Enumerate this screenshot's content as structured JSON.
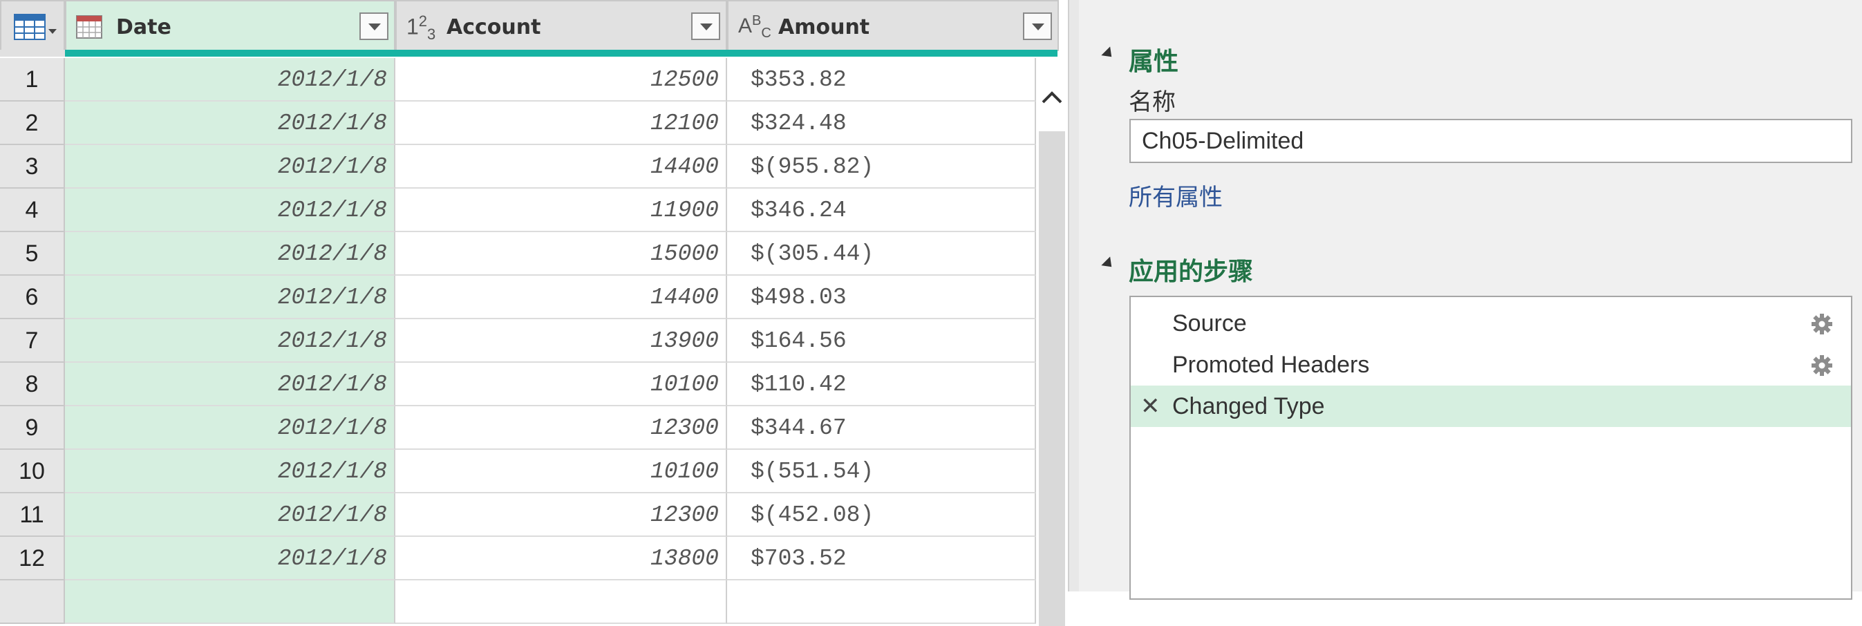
{
  "grid": {
    "columns": [
      {
        "name": "Date",
        "type_icon": "calendar-icon",
        "type_glyph": "▦"
      },
      {
        "name": "Account",
        "type_icon": "number-type-icon",
        "type_glyph": "1²₃"
      },
      {
        "name": "Amount",
        "type_icon": "text-type-icon",
        "type_glyph": "AᴮC"
      }
    ],
    "rows": [
      {
        "n": "1",
        "date": "2012/1/8",
        "account": "12500",
        "amount": "$353.82"
      },
      {
        "n": "2",
        "date": "2012/1/8",
        "account": "12100",
        "amount": "$324.48"
      },
      {
        "n": "3",
        "date": "2012/1/8",
        "account": "14400",
        "amount": "$(955.82)"
      },
      {
        "n": "4",
        "date": "2012/1/8",
        "account": "11900",
        "amount": "$346.24"
      },
      {
        "n": "5",
        "date": "2012/1/8",
        "account": "15000",
        "amount": "$(305.44)"
      },
      {
        "n": "6",
        "date": "2012/1/8",
        "account": "14400",
        "amount": "$498.03"
      },
      {
        "n": "7",
        "date": "2012/1/8",
        "account": "13900",
        "amount": "$164.56"
      },
      {
        "n": "8",
        "date": "2012/1/8",
        "account": "10100",
        "amount": "$110.42"
      },
      {
        "n": "9",
        "date": "2012/1/8",
        "account": "12300",
        "amount": "$344.67"
      },
      {
        "n": "10",
        "date": "2012/1/8",
        "account": "10100",
        "amount": "$(551.54)"
      },
      {
        "n": "11",
        "date": "2012/1/8",
        "account": "12300",
        "amount": "$(452.08)"
      },
      {
        "n": "12",
        "date": "2012/1/8",
        "account": "13800",
        "amount": "$703.52"
      }
    ],
    "colors": {
      "date_column_bg": "#d6efe0",
      "quality_bar": "#17b3a3"
    }
  },
  "pane": {
    "properties": {
      "title": "属性",
      "name_label": "名称",
      "name_value": "Ch05-Delimited",
      "all_properties_link": "所有属性"
    },
    "steps": {
      "title": "应用的步骤",
      "items": [
        {
          "label": "Source",
          "has_settings": true,
          "selected": false
        },
        {
          "label": "Promoted Headers",
          "has_settings": true,
          "selected": false
        },
        {
          "label": "Changed Type",
          "has_settings": false,
          "selected": true
        }
      ]
    },
    "colors": {
      "section_title": "#217346",
      "link": "#2f5597",
      "selected_step": "#d6efe0"
    }
  }
}
